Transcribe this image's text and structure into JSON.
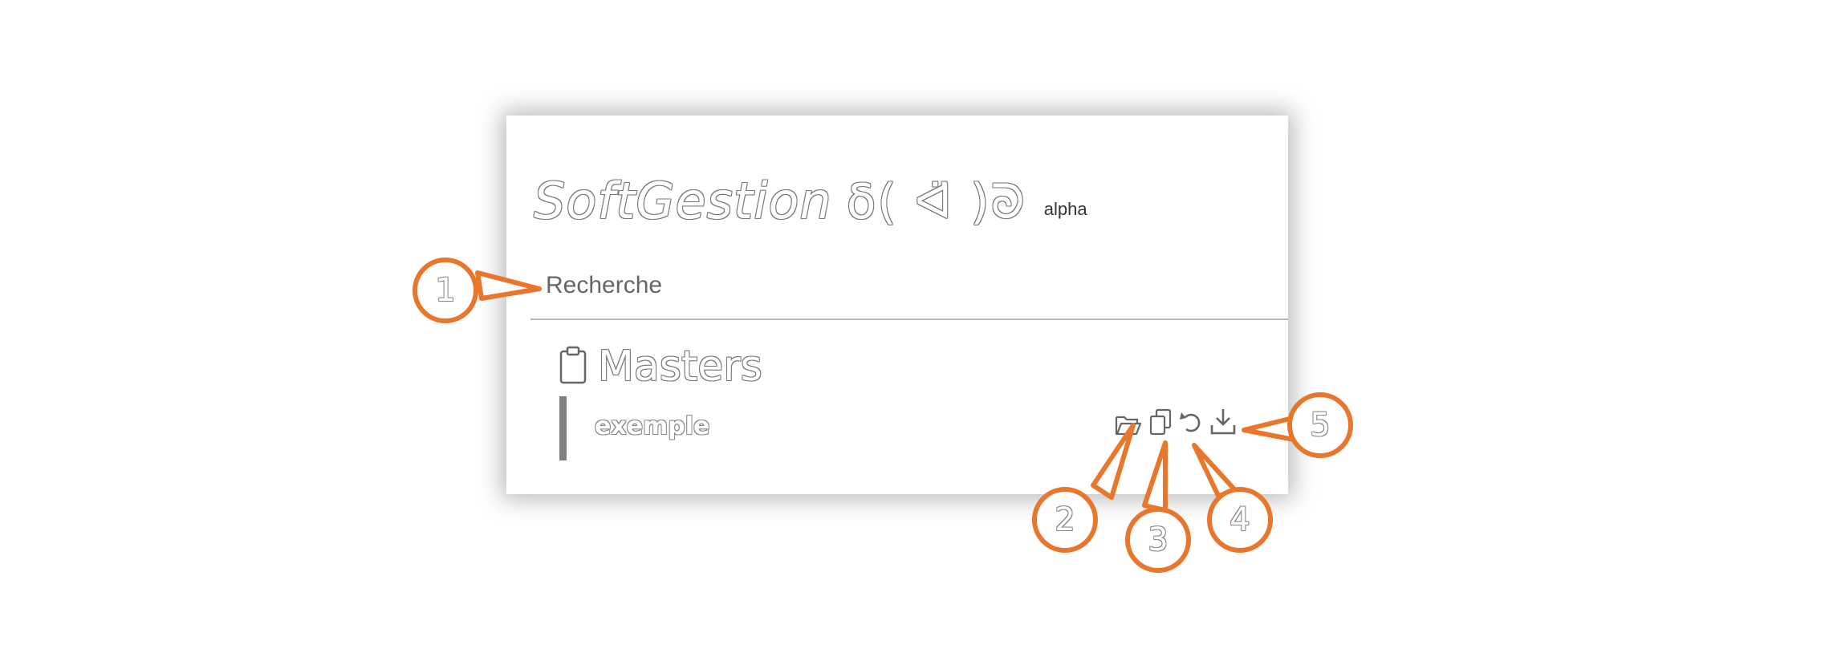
{
  "app": {
    "logo_text": "SoftGestion",
    "logo_glyphs": "δ( ᐊ̈ )ᘐ",
    "badge": "alpha"
  },
  "search": {
    "label": "Recherche"
  },
  "section": {
    "icon": "clipboard-icon",
    "title": "Masters"
  },
  "item": {
    "label": "exemple",
    "actions": [
      {
        "name": "open-folder-button",
        "icon": "folder-open-icon"
      },
      {
        "name": "duplicate-button",
        "icon": "copy-icon"
      },
      {
        "name": "restore-button",
        "icon": "undo-icon"
      },
      {
        "name": "download-button",
        "icon": "download-icon"
      }
    ]
  },
  "callouts": [
    "1",
    "2",
    "3",
    "4",
    "5"
  ],
  "colors": {
    "callout_orange": "#e8762c",
    "outline_gray": "#777777",
    "panel_bg": "#ffffff"
  }
}
